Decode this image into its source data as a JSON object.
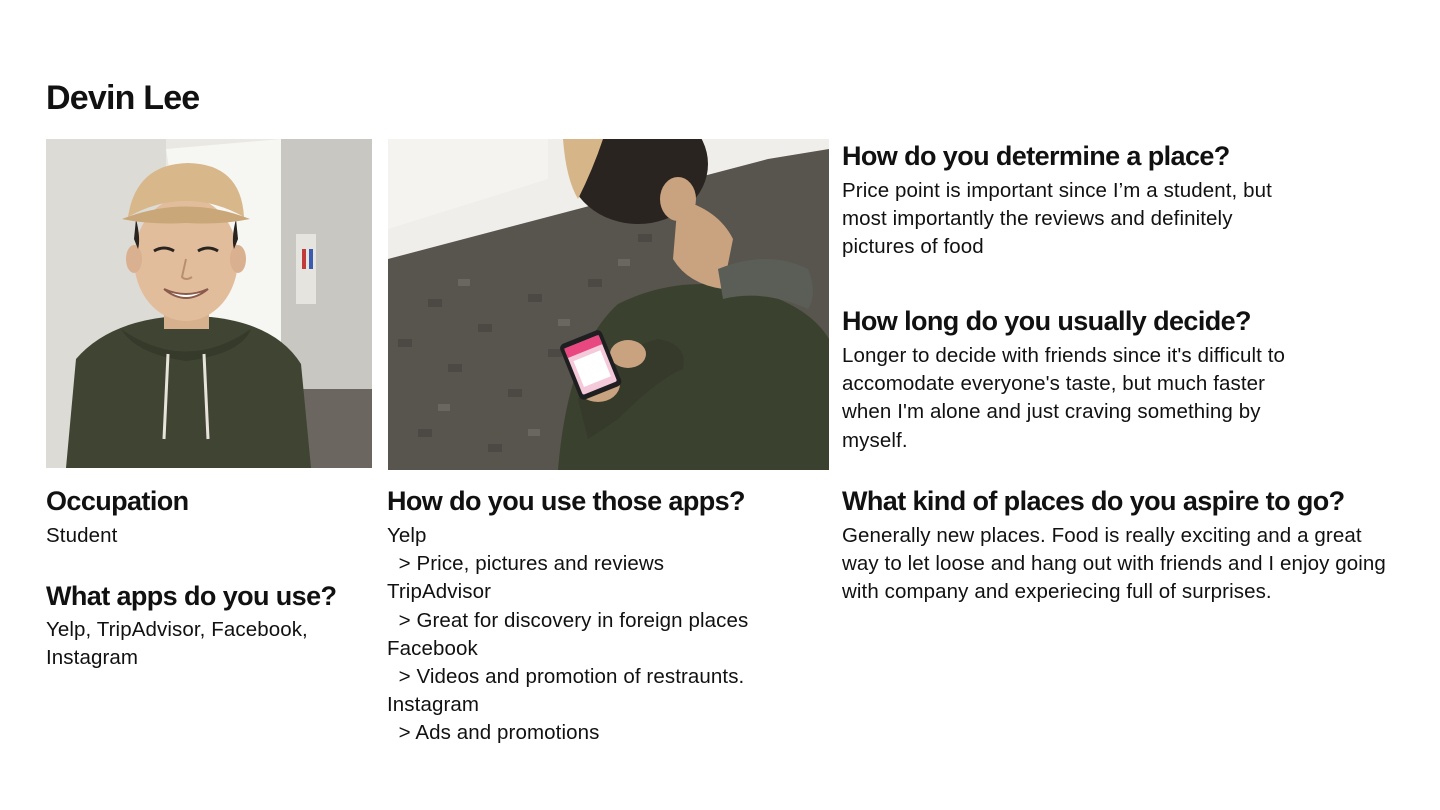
{
  "persona": {
    "name": "Devin Lee"
  },
  "occupation": {
    "heading": "Occupation",
    "value": "Student"
  },
  "apps_used": {
    "heading": "What apps do you use?",
    "value": "Yelp, TripAdvisor, Facebook, Instagram"
  },
  "apps_usage": {
    "heading": "How do you use those apps?",
    "lines": [
      "Yelp",
      "  > Price, pictures and reviews",
      "TripAdvisor",
      "  > Great for discovery in foreign places",
      "Facebook",
      "  > Videos and promotion of restraunts.",
      "Instagram",
      "  > Ads and promotions"
    ]
  },
  "determine_place": {
    "heading": "How do you determine a place?",
    "value": "Price point is important since I’m a student, but most importantly the reviews and definitely pictures of food"
  },
  "decide_time": {
    "heading": "How long do you usually decide?",
    "value": "Longer to decide with friends since it's difficult to accomodate everyone's taste, but much faster when I'm alone and just craving something by myself."
  },
  "aspire_places": {
    "heading": "What kind of places do you aspire to go?",
    "value": "Generally new places. Food is really exciting and a great way to let loose and hang out with friends and I enjoy going with company and experiecing full of surprises."
  },
  "colors": {
    "hoodie": "#3e4430",
    "cap": "#d9b98c",
    "carpet": "#5a5650",
    "wall": "#ecebe6",
    "phone_screen": "#f4c9da"
  }
}
